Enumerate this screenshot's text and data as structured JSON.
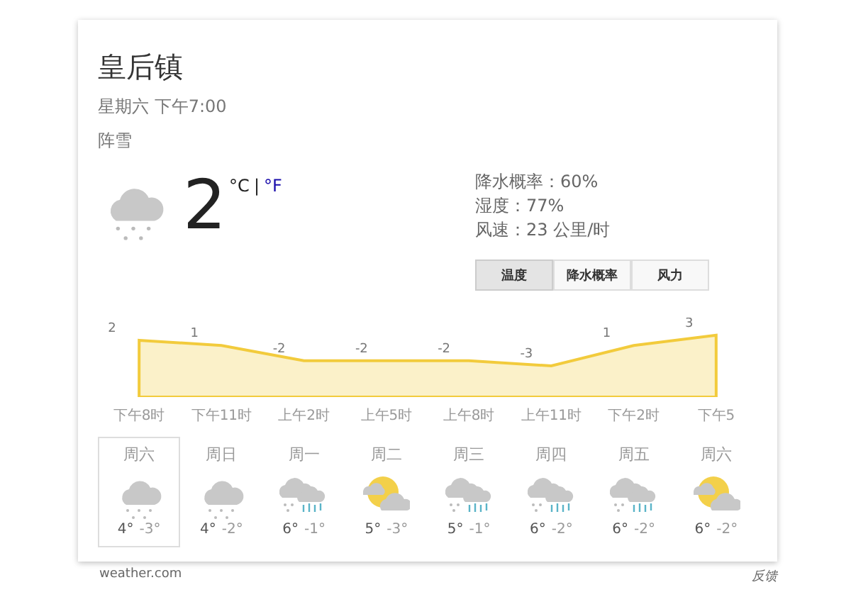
{
  "location": "皇后镇",
  "datetime": "星期六 下午7:00",
  "condition": "阵雪",
  "current": {
    "kind": "snow",
    "temperature": "2",
    "units": [
      {
        "label": "°C",
        "selected": true
      },
      {
        "label": "°F",
        "selected": false
      }
    ],
    "unit_separator": "|"
  },
  "details": [
    "降水概率：60%",
    "湿度：77%",
    "风速：23 公里/时"
  ],
  "tabs": [
    {
      "label": "温度",
      "selected": true
    },
    {
      "label": "降水概率",
      "selected": false
    },
    {
      "label": "风力",
      "selected": false
    }
  ],
  "chart_data": {
    "type": "area",
    "categories": [
      "下午8时",
      "下午11时",
      "上午2时",
      "上午5时",
      "上午8时",
      "上午11时",
      "下午2时",
      "下午5"
    ],
    "series": [
      {
        "color": "#f2cb3c",
        "values": [
          2,
          1,
          -2,
          -2,
          -2,
          -3,
          1,
          3
        ]
      }
    ],
    "data_labels": true
  },
  "days": [
    {
      "name": "周六",
      "kind": "snow",
      "high": "4°",
      "low": "-3°",
      "selected": true
    },
    {
      "name": "周日",
      "kind": "snow",
      "high": "4°",
      "low": "-2°",
      "selected": false
    },
    {
      "name": "周一",
      "kind": "snow-rain",
      "high": "6°",
      "low": "-1°",
      "selected": false
    },
    {
      "name": "周二",
      "kind": "partly-cloudy",
      "high": "5°",
      "low": "-3°",
      "selected": false
    },
    {
      "name": "周三",
      "kind": "snow-rain",
      "high": "5°",
      "low": "-1°",
      "selected": false
    },
    {
      "name": "周四",
      "kind": "snow-rain",
      "high": "6°",
      "low": "-2°",
      "selected": false
    },
    {
      "name": "周五",
      "kind": "snow-rain",
      "high": "6°",
      "low": "-2°",
      "selected": false
    },
    {
      "name": "周六",
      "kind": "partly-cloudy",
      "high": "6°",
      "low": "-2°",
      "selected": false
    }
  ],
  "footer": {
    "source": "weather.com",
    "feedback": "反馈"
  }
}
